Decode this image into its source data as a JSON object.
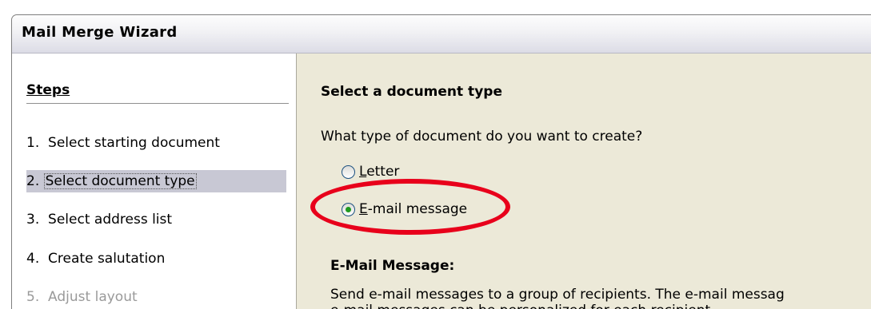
{
  "window": {
    "title": "Mail Merge Wizard"
  },
  "sidebar": {
    "heading": "Steps",
    "steps": [
      {
        "num": "1.",
        "label": "Select starting document",
        "state": "normal"
      },
      {
        "num": "2.",
        "label": "Select document type",
        "state": "active"
      },
      {
        "num": "3.",
        "label": "Select address list",
        "state": "normal"
      },
      {
        "num": "4.",
        "label": "Create salutation",
        "state": "normal"
      },
      {
        "num": "5.",
        "label": "Adjust layout",
        "state": "disabled"
      }
    ]
  },
  "main": {
    "section_title": "Select a document type",
    "question": "What type of document do you want to create?",
    "options": [
      {
        "label": "Letter",
        "accel": "L",
        "rest": "etter",
        "selected": false
      },
      {
        "label": "E-mail message",
        "accel": "E",
        "rest": "-mail message",
        "selected": true
      }
    ],
    "description_title": "E-Mail Message:",
    "description_line1": "Send e-mail messages to a group of recipients. The e-mail messag",
    "description_line2": "e-mail messages can be personalized for each recipient."
  },
  "colors": {
    "highlight": "#e8001b",
    "active_step_bg": "#c8c8d4",
    "radio_dot": "#1f9a1f"
  }
}
